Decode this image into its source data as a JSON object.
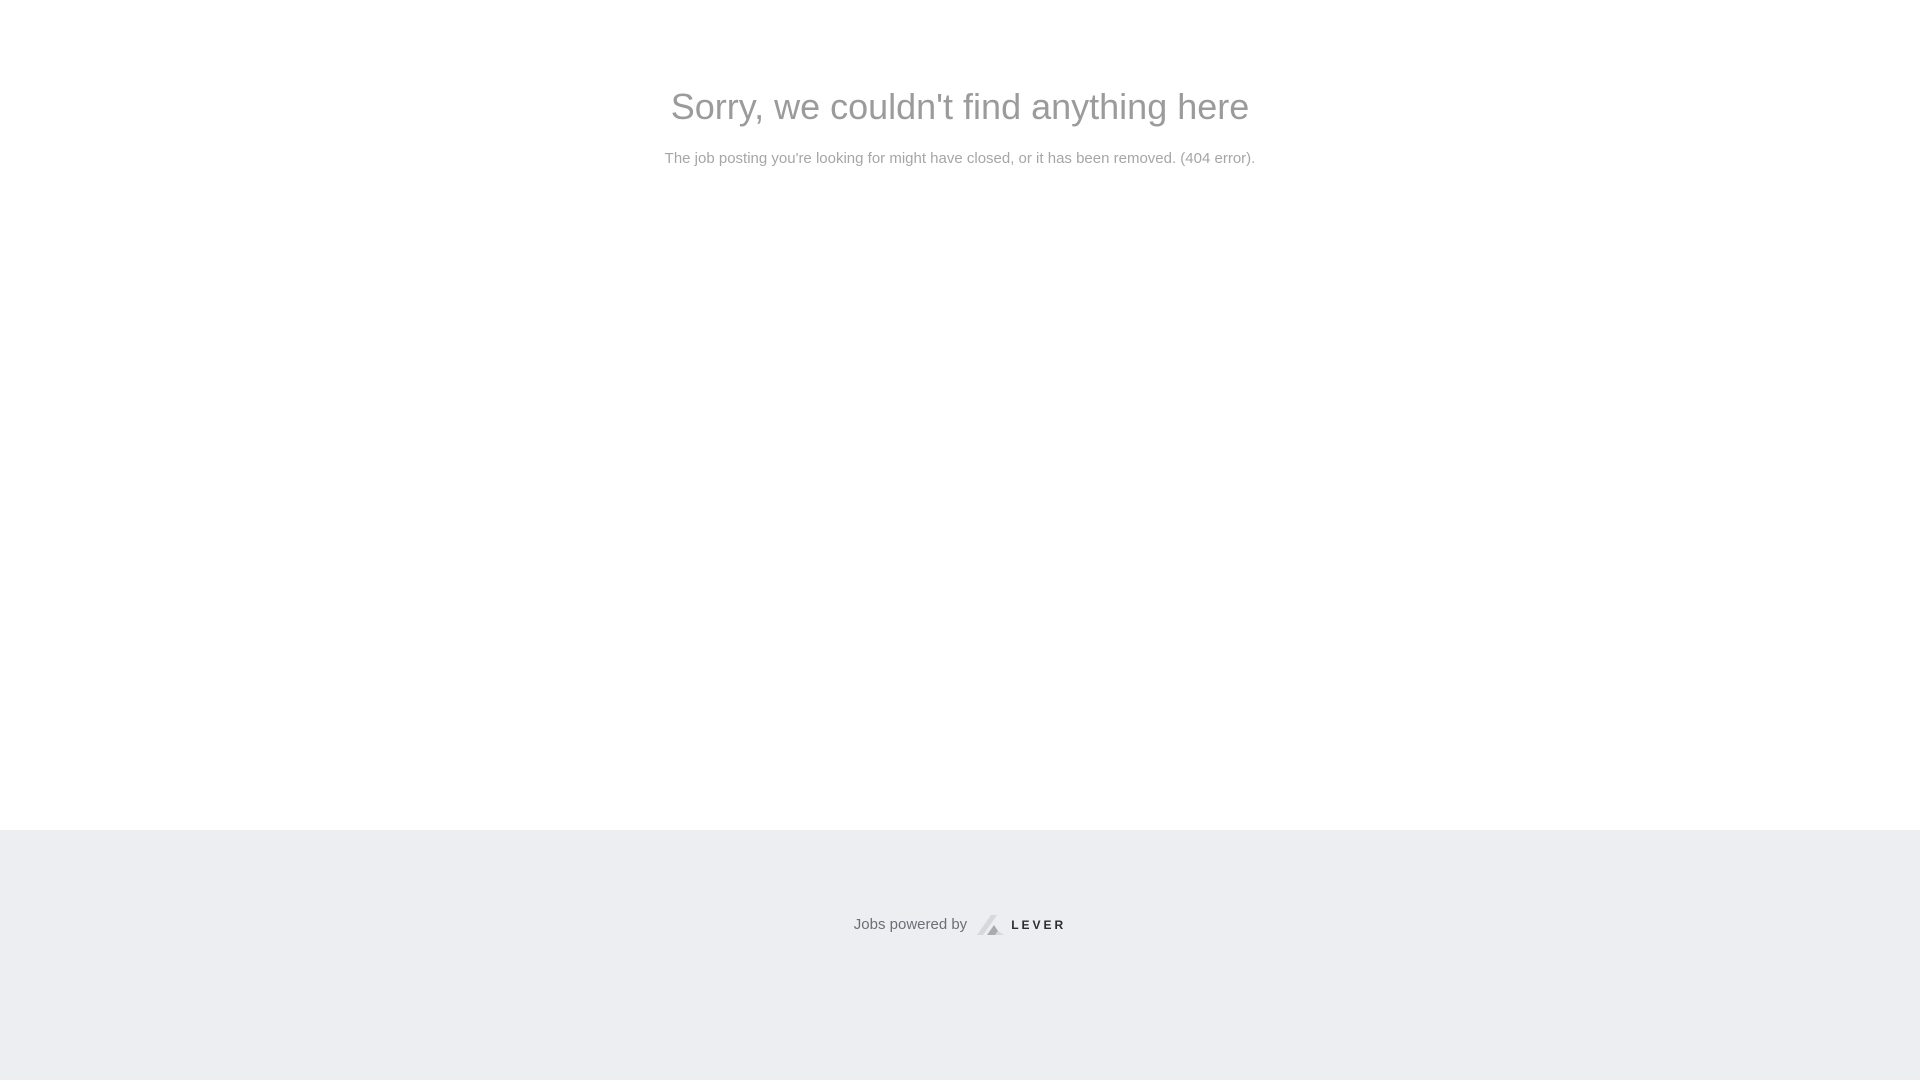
{
  "error": {
    "title": "Sorry, we couldn't find anything here",
    "subtitle": "The job posting you're looking for might have closed, or it has been removed. (404 error)."
  },
  "footer": {
    "powered_by": "Jobs powered by",
    "brand": "LEVER",
    "logo_icon": "lever-logo-icon"
  },
  "colors": {
    "footer_background": "#edeef2",
    "title_text": "#9b9b9b",
    "subtitle_text": "#a6a6a6",
    "brand_text": "#2b2d33",
    "logo_light": "#d7d8dc",
    "logo_dark": "#a9abb1"
  }
}
